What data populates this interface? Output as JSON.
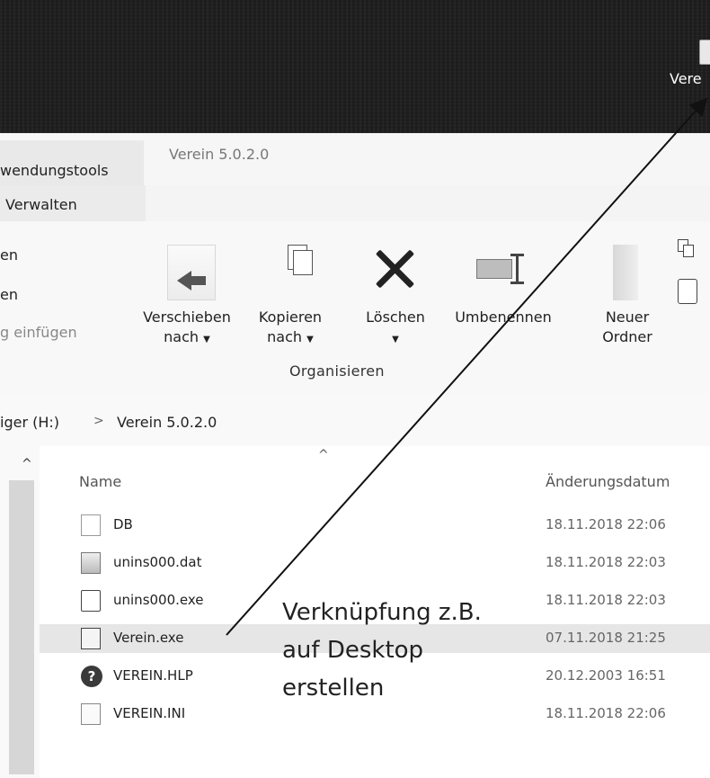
{
  "desktop": {
    "shortcut_label": "Vere"
  },
  "titlebar": {
    "context_tab": "wendungstools",
    "window_title": "Verein 5.0.2.0",
    "manage_tab": "Verwalten"
  },
  "ribbon": {
    "clipboard_items": [
      "en",
      "en",
      "g einfügen"
    ],
    "buttons": {
      "move": [
        "Verschieben",
        "nach"
      ],
      "copy": [
        "Kopieren",
        "nach"
      ],
      "delete": "Löschen",
      "rename": "Umbenennen",
      "new_folder": [
        "Neuer",
        "Ordner"
      ]
    },
    "group_label": "Organisieren"
  },
  "address": {
    "drive": "iger (H:)",
    "separator": ">",
    "folder": "Verein 5.0.2.0"
  },
  "file_list": {
    "columns": {
      "name": "Name",
      "date": "Änderungsdatum"
    },
    "rows": [
      {
        "icon": "blank-document-icon",
        "name": "DB",
        "date": "18.11.2018 22:06"
      },
      {
        "icon": "data-file-icon",
        "name": "unins000.dat",
        "date": "18.11.2018 22:03"
      },
      {
        "icon": "setup-program-icon",
        "name": "unins000.exe",
        "date": "18.11.2018 22:03"
      },
      {
        "icon": "application-icon",
        "name": "Verein.exe",
        "date": "07.11.2018 21:25"
      },
      {
        "icon": "help-file-icon",
        "name": "VEREIN.HLP",
        "date": "20.12.2003 16:51"
      },
      {
        "icon": "settings-file-icon",
        "name": "VEREIN.INI",
        "date": "18.11.2018 22:06"
      }
    ]
  },
  "annotation": {
    "lines": [
      "Verknüpfung z.B.",
      "auf Desktop",
      "erstellen"
    ]
  }
}
